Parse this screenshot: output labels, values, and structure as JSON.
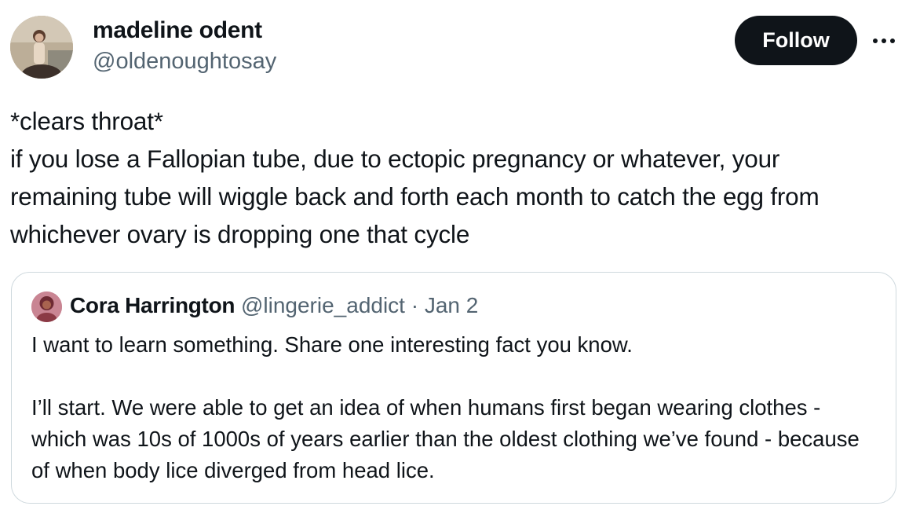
{
  "author": {
    "display_name": "madeline odent",
    "handle": "@oldenoughtosay"
  },
  "actions": {
    "follow_label": "Follow",
    "more_icon": "ellipsis-icon"
  },
  "tweet": {
    "text": "*clears throat*\nif you lose a Fallopian tube, due to ectopic pregnancy or whatever, your remaining tube will wiggle back and forth each month to catch the egg from whichever ovary is dropping one that cycle"
  },
  "quoted_tweet": {
    "display_name": "Cora Harrington",
    "handle": "@lingerie_addict",
    "separator": "·",
    "date": "Jan 2",
    "text": "I want to learn something. Share one interesting fact you know.\n\nI’ll start. We were able to get an idea of when humans first began wearing clothes - which was 10s of 1000s of years earlier than the oldest clothing we’ve found - because of when body lice diverged from head lice."
  },
  "colors": {
    "text_primary": "#0f1419",
    "text_secondary": "#536471",
    "border": "#cfd9de",
    "button_bg": "#0f1419",
    "button_text": "#ffffff"
  }
}
